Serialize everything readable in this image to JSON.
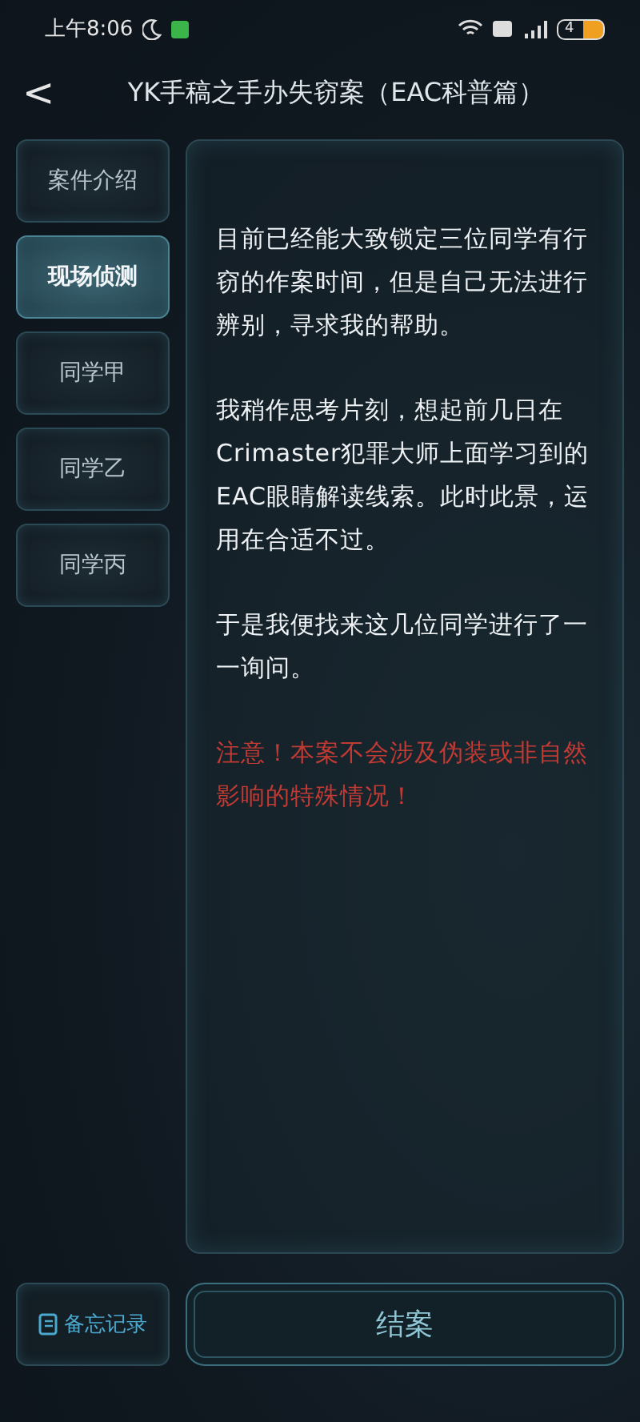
{
  "status_bar": {
    "time": "上午8:06",
    "battery": "4"
  },
  "header": {
    "back": "<",
    "title": "YK手稿之手办失窃案（EAC科普篇）"
  },
  "tabs": [
    {
      "label": "案件介绍",
      "selected": false
    },
    {
      "label": "现场侦测",
      "selected": true
    },
    {
      "label": "同学甲",
      "selected": false
    },
    {
      "label": "同学乙",
      "selected": false
    },
    {
      "label": "同学丙",
      "selected": false
    }
  ],
  "paragraphs": [
    {
      "kind": "normal",
      "text": "目前已经能大致锁定三位同学有行窃的作案时间，但是自己无法进行辨别，寻求我的帮助。"
    },
    {
      "kind": "normal",
      "text": "我稍作思考片刻，想起前几日在Crimaster犯罪大师上面学习到的EAC眼睛解读线索。此时此景，运用在合适不过。"
    },
    {
      "kind": "normal",
      "text": "于是我便找来这几位同学进行了一一询问。"
    },
    {
      "kind": "warning",
      "text": "注意！本案不会涉及伪装或非自然影响的特殊情况！"
    }
  ],
  "memo_button": "备忘记录",
  "close_case_button": "结案"
}
